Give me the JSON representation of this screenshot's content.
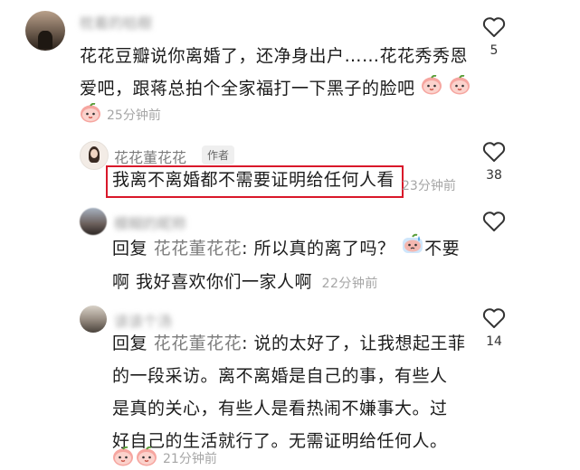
{
  "comments": [
    {
      "username": "枕着的枯樹",
      "text": "花花豆瓣说你离婚了，还净身出户……花花秀秀恩爱吧，跟蒋总拍个全家福打一下黑子的脸吧",
      "line1": "花花豆瓣说你离婚了，还净身出户……花花秀秀恩",
      "line2": "爱吧，跟蒋总拍个全家福打一下黑子的脸吧",
      "time": "25分钟前",
      "likes": "5"
    },
    {
      "username": "花花董花花",
      "author_tag": "作者",
      "text": "我离不离婚都不需要证明给任何人看",
      "time": "23分钟前",
      "likes": "38"
    },
    {
      "username": "模糊的昵称",
      "reply_prefix": "回复",
      "reply_to": "花花董花花",
      "line1_rest": ": 所以真的离了吗？",
      "line1_tail": "不要",
      "line2": "啊 我好喜欢你们一家人啊",
      "time": "22分钟前",
      "likes": ""
    },
    {
      "username": "该该个汤",
      "reply_prefix": "回复",
      "reply_to": "花花董花花",
      "line1_rest": ": 说的太好了，让我想起王菲",
      "line2": "的一段采访。离不离婚是自己的事，有些人",
      "line3": "是真的关心，有些人是看热闹不嫌事大。过",
      "line4": "好自己的生活就行了。无需证明给任何人。",
      "time": "21分钟前",
      "likes": "14"
    }
  ],
  "icons": {
    "like": "heart-outline-icon",
    "peach_emoji": "peach-emoji-icon",
    "sweat_emoji": "sweat-emoji-icon"
  },
  "colors": {
    "highlight_border": "#d9182a",
    "secondary_text": "#7d7d7d",
    "time_text": "#a6a6a6"
  }
}
